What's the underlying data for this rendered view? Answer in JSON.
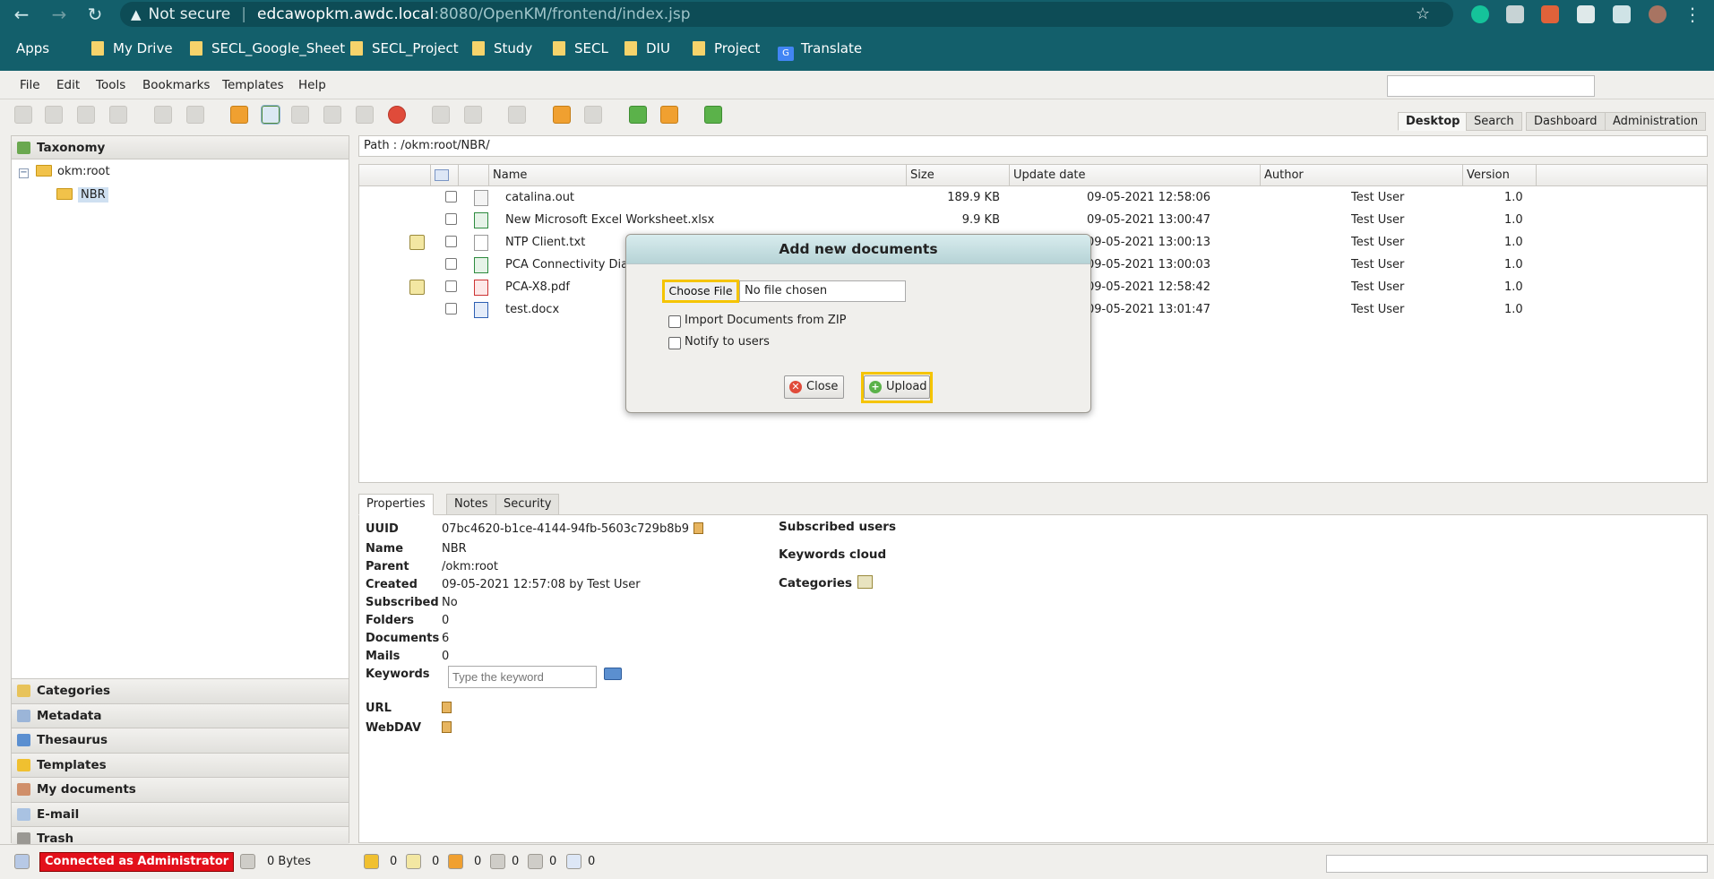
{
  "browser": {
    "not_secure": "Not secure",
    "url_host": "edcawopkm.awdc.local",
    "url_path": ":8080/OpenKM/frontend/index.jsp",
    "bookmarks": [
      "Apps",
      "My Drive",
      "SECL_Google_Sheet",
      "SECL_Project",
      "Study",
      "SECL",
      "DIU",
      "Project",
      "Translate"
    ]
  },
  "menu": [
    "File",
    "Edit",
    "Tools",
    "Bookmarks",
    "Templates",
    "Help"
  ],
  "top_tabs": [
    "Desktop",
    "Search",
    "Dashboard",
    "Administration"
  ],
  "left_panel": {
    "taxonomy": "Taxonomy",
    "tree_root": "okm:root",
    "tree_child": "NBR",
    "sections": [
      "Categories",
      "Metadata",
      "Thesaurus",
      "Templates",
      "My documents",
      "E-mail",
      "Trash"
    ]
  },
  "path": "Path : /okm:root/NBR/",
  "grid": {
    "columns": [
      "Name",
      "Size",
      "Update date",
      "Author",
      "Version"
    ],
    "rows": [
      {
        "name": "catalina.out",
        "size": "189.9 KB",
        "date": "09-05-2021 12:58:06",
        "author": "Test User",
        "version": "1.0",
        "type": "out",
        "edit": false
      },
      {
        "name": "New Microsoft Excel Worksheet.xlsx",
        "size": "9.9 KB",
        "date": "09-05-2021 13:00:47",
        "author": "Test User",
        "version": "1.0",
        "type": "xls",
        "edit": false
      },
      {
        "name": "NTP Client.txt",
        "size": "",
        "date": "09-05-2021 13:00:13",
        "author": "Test User",
        "version": "1.0",
        "type": "txt",
        "edit": true
      },
      {
        "name": "PCA Connectivity Diag",
        "size": "",
        "date": "09-05-2021 13:00:03",
        "author": "Test User",
        "version": "1.0",
        "type": "xls",
        "edit": false
      },
      {
        "name": "PCA-X8.pdf",
        "size": "",
        "date": "09-05-2021 12:58:42",
        "author": "Test User",
        "version": "1.0",
        "type": "pdf",
        "edit": true
      },
      {
        "name": "test.docx",
        "size": "",
        "date": "09-05-2021 13:01:47",
        "author": "Test User",
        "version": "1.0",
        "type": "doc",
        "edit": false
      }
    ]
  },
  "bottom_tabs": [
    "Properties",
    "Notes",
    "Security"
  ],
  "properties": {
    "uuid_label": "UUID",
    "uuid": "07bc4620-b1ce-4144-94fb-5603c729b8b9",
    "name_label": "Name",
    "name": "NBR",
    "parent_label": "Parent",
    "parent": "/okm:root",
    "created_label": "Created",
    "created": "09-05-2021 12:57:08 by Test User",
    "subscribed_label": "Subscribed",
    "subscribed": "No",
    "folders_label": "Folders",
    "folders": "0",
    "documents_label": "Documents",
    "documents": "6",
    "mails_label": "Mails",
    "mails": "0",
    "keywords_label": "Keywords",
    "keywords_placeholder": "Type the keyword",
    "url_label": "URL",
    "webdav_label": "WebDAV",
    "subscribed_users": "Subscribed users",
    "keywords_cloud": "Keywords cloud",
    "categories": "Categories"
  },
  "dialog": {
    "title": "Add new documents",
    "choose_file": "Choose File",
    "no_file": "No file chosen",
    "import_zip": "Import Documents from ZIP",
    "notify": "Notify to users",
    "close": "Close",
    "upload": "Upload"
  },
  "status": {
    "connected": "Connected as Administrator",
    "bytes": "0 Bytes",
    "counters": [
      "0",
      "0",
      "0",
      "0",
      "0",
      "0"
    ]
  }
}
